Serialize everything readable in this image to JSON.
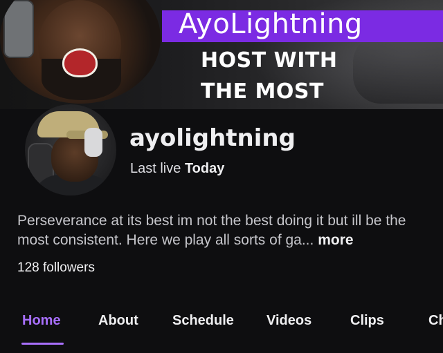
{
  "banner": {
    "name": "AyoLightning",
    "line1": "HOST WITH",
    "line2": "THE MOST"
  },
  "profile": {
    "username": "ayolightning",
    "last_live_prefix": "Last live",
    "last_live_value": "Today",
    "bio_text": "Perseverance at its best im not the best doing it but ill be the most consistent. Here we play all sorts of ga...",
    "bio_more": "more",
    "followers_count": "128",
    "followers_label": "followers"
  },
  "tabs": [
    {
      "label": "Home",
      "active": true
    },
    {
      "label": "About",
      "active": false
    },
    {
      "label": "Schedule",
      "active": false
    },
    {
      "label": "Videos",
      "active": false
    },
    {
      "label": "Clips",
      "active": false
    },
    {
      "label": "Ch",
      "active": false
    }
  ],
  "colors": {
    "accent": "#a970ff",
    "banner_purple": "#7b2be3",
    "background": "#0e0e10"
  }
}
